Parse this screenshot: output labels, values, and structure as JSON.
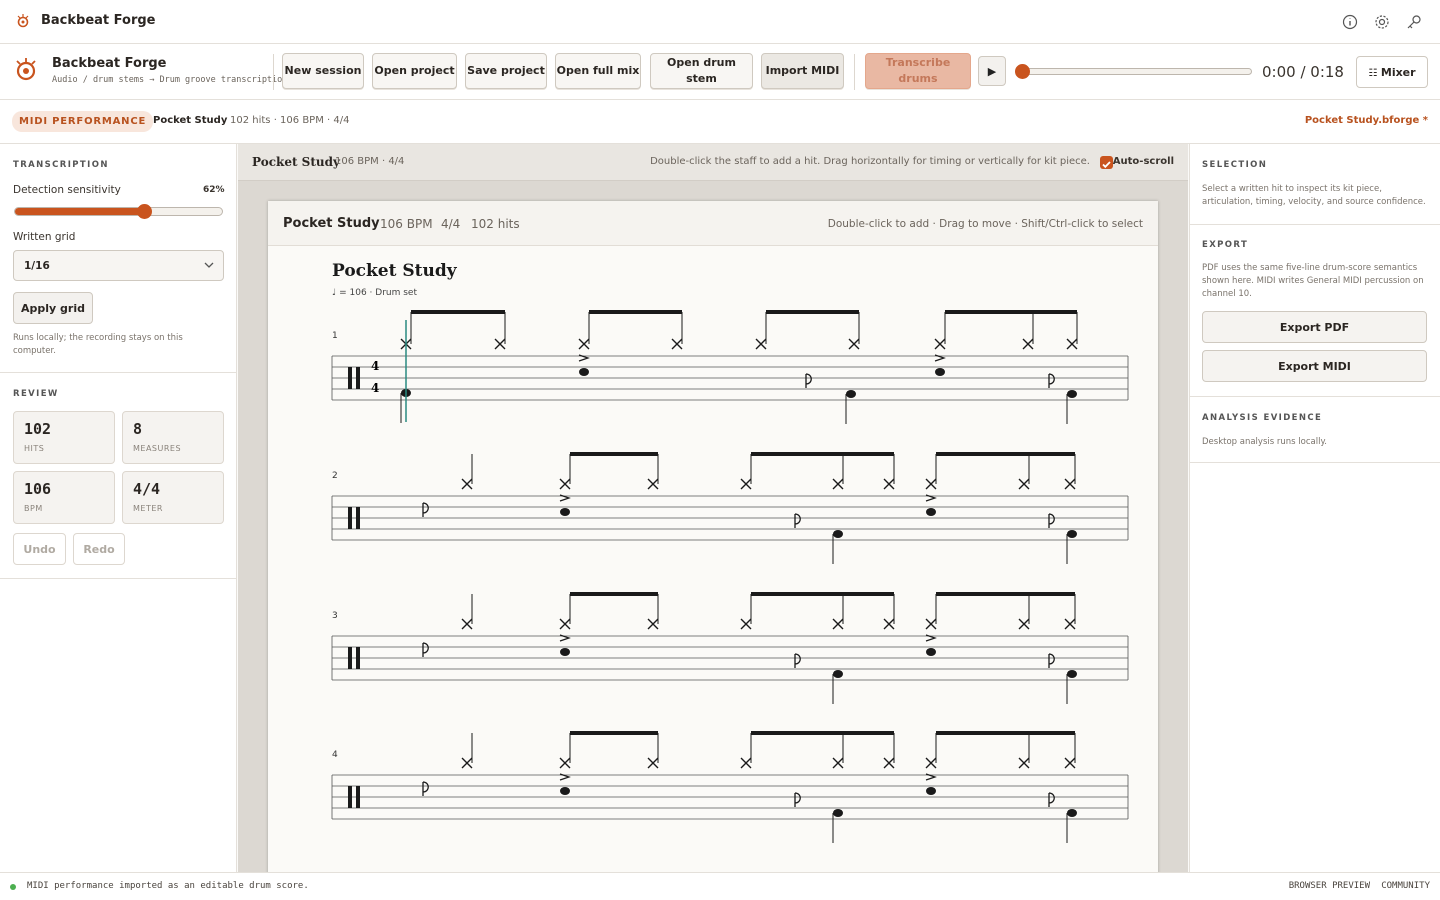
{
  "titlebar": {
    "title": "Backbeat Forge"
  },
  "toolbar": {
    "app_name": "Backbeat Forge",
    "app_subtitle": "Audio / drum stems → Drum groove transcription",
    "buttons": {
      "new_session": "New session",
      "open_project": "Open project",
      "save_project": "Save project",
      "open_full_mix": "Open full mix",
      "open_drum_stem": "Open drum stem",
      "import_midi": "Import MIDI",
      "transcribe_drums": "Transcribe drums"
    },
    "time": "0:00 / 0:18",
    "playback_progress": 0.0,
    "mixer_label": "Mixer"
  },
  "subheader": {
    "badge": "MIDI PERFORMANCE",
    "name": "Pocket Study",
    "meta": "102 hits · 106 BPM · 4/4",
    "file": "Pocket Study.bforge *"
  },
  "left": {
    "transcription_heading": "TRANSCRIPTION",
    "sensitivity_label": "Detection sensitivity",
    "sensitivity_value": "62%",
    "sensitivity_fraction": 0.62,
    "grid_label": "Written grid",
    "grid_value": "1/16",
    "apply_grid": "Apply grid",
    "local_note": "Runs locally; the recording stays on this computer.",
    "review_heading": "REVIEW",
    "stats": [
      {
        "value": "102",
        "label": "HITS"
      },
      {
        "value": "8",
        "label": "MEASURES"
      },
      {
        "value": "106",
        "label": "BPM"
      },
      {
        "value": "4/4",
        "label": "METER"
      }
    ],
    "undo": "Undo",
    "redo": "Redo"
  },
  "center": {
    "name": "Pocket Study",
    "meta": "106 BPM · 4/4",
    "hint": "Double-click the staff to add a hit. Drag horizontally for timing or vertically for kit piece.",
    "autoscroll": "Auto-scroll",
    "paper": {
      "name": "Pocket Study",
      "bpm": "106 BPM",
      "meter": "4/4",
      "hits": "102 hits",
      "hint": "Double-click to add · Drag to move · Shift/Ctrl-click to select",
      "score_title": "Pocket Study",
      "tempo_marking": "♩ = 106 · Drum set",
      "time_sig_top": "4",
      "time_sig_bottom": "4",
      "measure_numbers": [
        "1",
        "2",
        "3",
        "4"
      ]
    }
  },
  "right": {
    "selection_heading": "SELECTION",
    "selection_text": "Select a written hit to inspect its kit piece, articulation, timing, velocity, and source confidence.",
    "export_heading": "EXPORT",
    "export_text": "PDF uses the same five-line drum-score semantics shown here. MIDI writes General MIDI percussion on channel 10.",
    "export_pdf": "Export PDF",
    "export_midi": "Export MIDI",
    "analysis_heading": "ANALYSIS EVIDENCE",
    "analysis_text": "Desktop analysis runs locally."
  },
  "status": {
    "message": "MIDI performance imported as an editable drum score.",
    "browser_preview": "BROWSER PREVIEW",
    "community": "COMMUNITY"
  },
  "colors": {
    "accent": "#c9541e",
    "badge_bg": "#f8e6dc",
    "ok": "#4caf50",
    "playhead": "#2a8a80"
  }
}
